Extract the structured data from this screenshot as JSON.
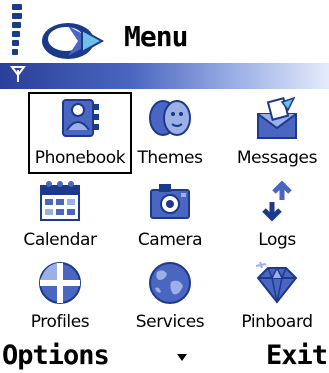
{
  "status": {
    "title": "Menu",
    "signal_icon": "signal-strength-icon",
    "antenna_icon": "antenna-icon"
  },
  "menu": {
    "items": [
      {
        "label": "Phonebook",
        "icon": "phonebook-icon",
        "selected": true
      },
      {
        "label": "Themes",
        "icon": "themes-icon",
        "selected": false
      },
      {
        "label": "Messages",
        "icon": "messages-icon",
        "selected": false
      },
      {
        "label": "Calendar",
        "icon": "calendar-icon",
        "selected": false
      },
      {
        "label": "Camera",
        "icon": "camera-icon",
        "selected": false
      },
      {
        "label": "Logs",
        "icon": "logs-icon",
        "selected": false
      },
      {
        "label": "Profiles",
        "icon": "profiles-icon",
        "selected": false
      },
      {
        "label": "Services",
        "icon": "services-icon",
        "selected": false
      },
      {
        "label": "Pinboard",
        "icon": "pinboard-icon",
        "selected": false
      }
    ]
  },
  "softkeys": {
    "left": "Options",
    "right": "Exit",
    "scroll_icon": "scroll-down-icon"
  },
  "colors": {
    "accent_dark": "#1c3a8c",
    "accent_mid": "#4a66c0",
    "accent_light": "#9db0e6"
  }
}
